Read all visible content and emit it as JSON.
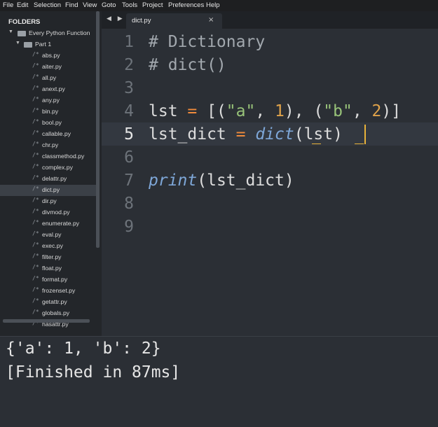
{
  "menu": {
    "items": [
      "File",
      "Edit",
      "Selection",
      "Find",
      "View",
      "Goto",
      "Tools",
      "Project",
      "Preferences",
      "Help"
    ]
  },
  "sidebar": {
    "title": "FOLDERS",
    "root_folder": "Every Python Function",
    "sub_folder": "Part 1",
    "file_marker": "/*",
    "selected_file": "dict.py",
    "files": [
      "abs.py",
      "aiter.py",
      "all.py",
      "anext.py",
      "any.py",
      "bin.py",
      "bool.py",
      "callable.py",
      "chr.py",
      "classmethod.py",
      "complex.py",
      "delattr.py",
      "dict.py",
      "dir.py",
      "divmod.py",
      "enumerate.py",
      "eval.py",
      "exec.py",
      "filter.py",
      "float.py",
      "format.py",
      "frozenset.py",
      "getattr.py",
      "globals.py",
      "hasattr.py"
    ]
  },
  "tabs": {
    "nav_arrows": "◀ ▶",
    "active": "dict.py",
    "close": "×"
  },
  "editor": {
    "current_line": 5,
    "line_numbers": [
      "1",
      "2",
      "3",
      "4",
      "5",
      "6",
      "7",
      "8",
      "9"
    ],
    "code": {
      "l1": "# Dictionary",
      "l2": "# dict()",
      "l4_var": "lst ",
      "l4_eq": "=",
      "l4_open": " [(",
      "l4_s1": "\"a\"",
      "l4_sep1": ", ",
      "l4_n1": "1",
      "l4_mid": "), (",
      "l4_s2": "\"b\"",
      "l4_sep2": ", ",
      "l4_n2": "2",
      "l4_close": ")]",
      "l5_var": "lst_dict ",
      "l5_eq": "=",
      "l5_sp": " ",
      "l5_fn": "dict",
      "l5_args": "(lst)",
      "l7_fn": "print",
      "l7_args": "(lst_dict)"
    }
  },
  "console": {
    "output": "{'a': 1, 'b': 2}",
    "status": "[Finished in 87ms]"
  },
  "colors": {
    "background": "#2b2f35",
    "sidebar": "#23262a",
    "operator": "#f08b3c",
    "string": "#98c379",
    "number": "#e0a34a",
    "function": "#7ea7d8",
    "caret": "#e8b23a"
  }
}
